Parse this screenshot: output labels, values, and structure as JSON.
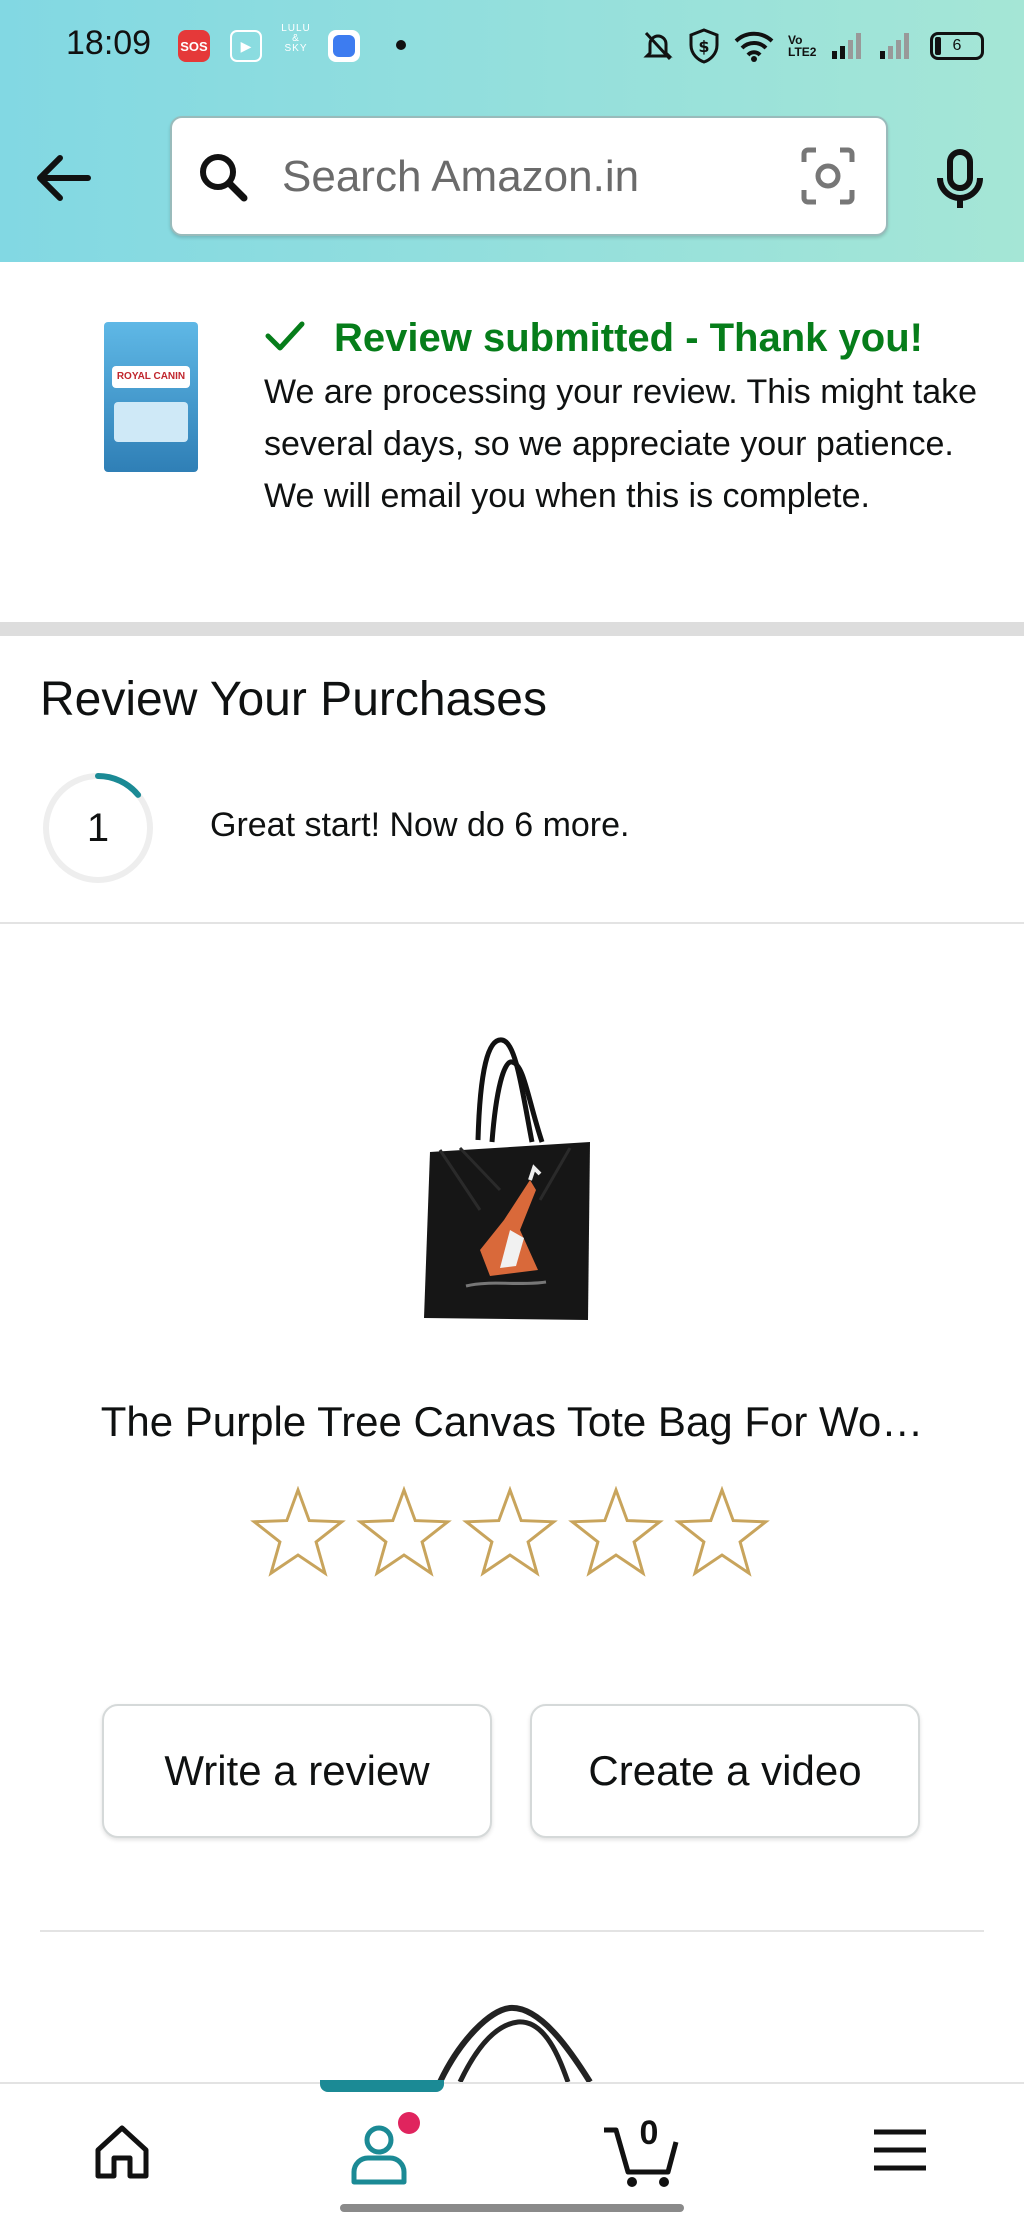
{
  "status_bar": {
    "time": "18:09",
    "sos_label": "SOS",
    "app_label_line1": "LULU",
    "app_label_line2": "&",
    "app_label_line3": "SKY",
    "volte_label": "Vo LTE2",
    "battery_level": "6"
  },
  "search": {
    "placeholder": "Search Amazon.in"
  },
  "notice": {
    "title": "Review submitted - Thank you!",
    "body": "We are processing your review. This might take several days, so we appreciate your patience. We will email you when this is complete.",
    "product_brand": "ROYAL CANIN"
  },
  "review_section": {
    "heading": "Review Your Purchases",
    "progress_count": "1",
    "progress_fraction": 0.14,
    "progress_text": "Great start! Now do 6 more."
  },
  "product": {
    "title": "The Purple Tree Canvas Tote Bag For Wo…",
    "rating": 0,
    "max_rating": 5
  },
  "buttons": {
    "write_review": "Write a review",
    "create_video": "Create a video"
  },
  "bottom_nav": {
    "cart_count": "0",
    "active_tab": "account"
  },
  "colors": {
    "accent_teal": "#1b8a95",
    "success_green": "#067d1a",
    "star_outline": "#c8a45c",
    "notification_dot": "#e0245e"
  }
}
